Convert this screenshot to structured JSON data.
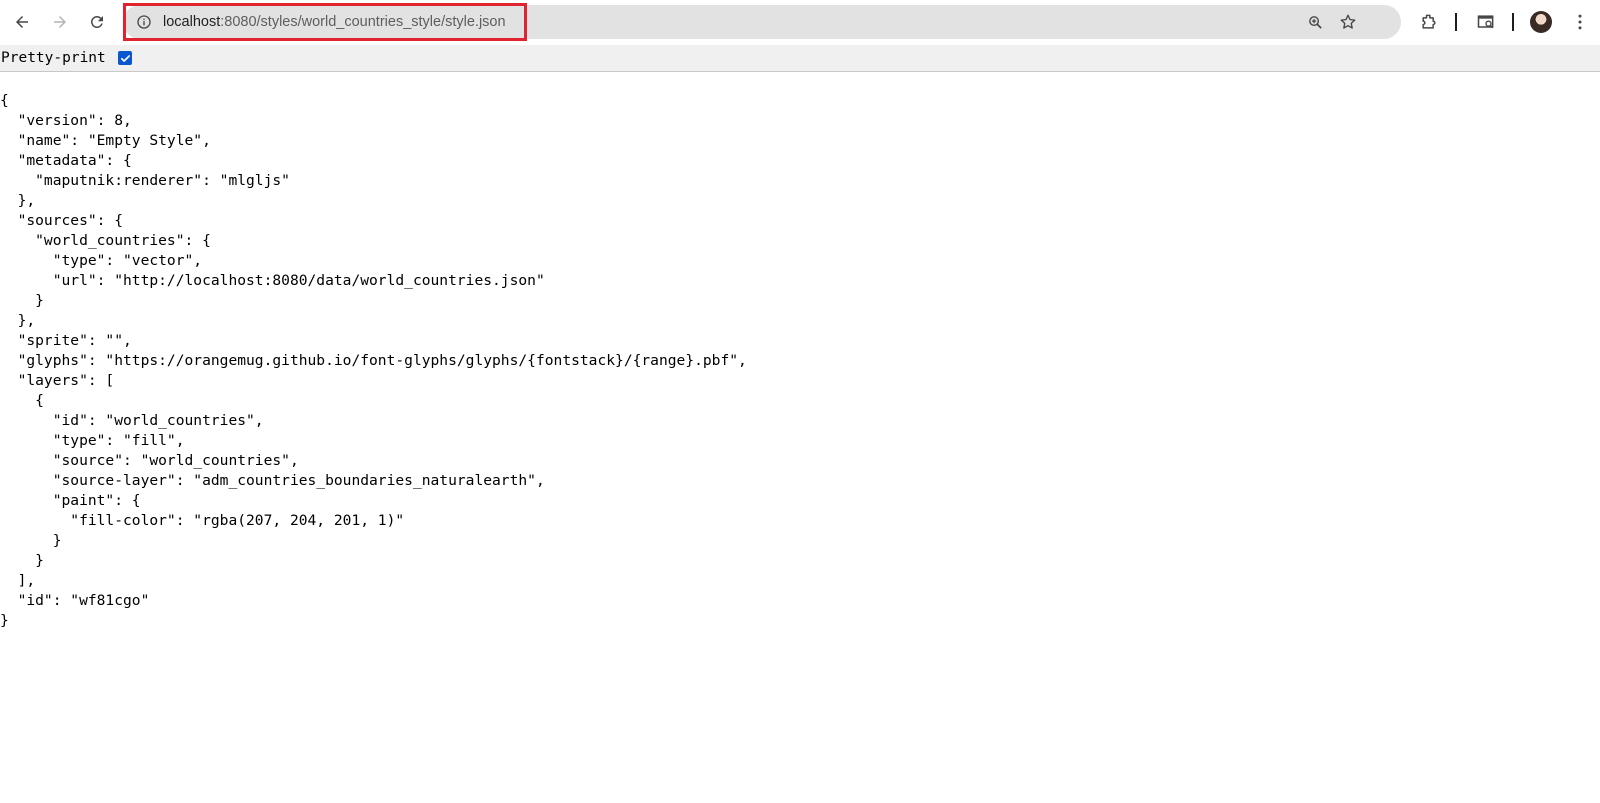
{
  "browser": {
    "url_host": "localhost",
    "url_rest": ":8080/styles/world_countries_style/style.json"
  },
  "pretty_print": {
    "label": "Pretty-print",
    "checked": true
  },
  "json_lines": [
    "{",
    "  \"version\": 8,",
    "  \"name\": \"Empty Style\",",
    "  \"metadata\": {",
    "    \"maputnik:renderer\": \"mlgljs\"",
    "  },",
    "  \"sources\": {",
    "    \"world_countries\": {",
    "      \"type\": \"vector\",",
    "      \"url\": \"http://localhost:8080/data/world_countries.json\"",
    "    }",
    "  },",
    "  \"sprite\": \"\",",
    "  \"glyphs\": \"https://orangemug.github.io/font-glyphs/glyphs/{fontstack}/{range}.pbf\",",
    "  \"layers\": [",
    "    {",
    "      \"id\": \"world_countries\",",
    "      \"type\": \"fill\",",
    "      \"source\": \"world_countries\",",
    "      \"source-layer\": \"adm_countries_boundaries_naturalearth\",",
    "      \"paint\": {",
    "        \"fill-color\": \"rgba(207, 204, 201, 1)\"",
    "      }",
    "    }",
    "  ],",
    "  \"id\": \"wf81cgo\"",
    "}"
  ],
  "colors": {
    "highlight": "#e0232e",
    "checkbox": "#0b57d0",
    "omnibox": "#e2e2e2"
  }
}
